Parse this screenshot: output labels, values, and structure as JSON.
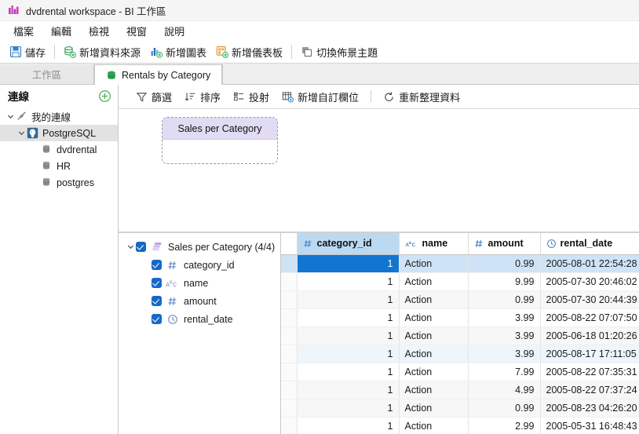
{
  "window": {
    "title": "dvdrental workspace - BI 工作區",
    "icon": "bar-chart-icon"
  },
  "menubar": {
    "items": [
      {
        "label": "檔案"
      },
      {
        "label": "編輯"
      },
      {
        "label": "檢視"
      },
      {
        "label": "視窗"
      },
      {
        "label": "說明"
      }
    ]
  },
  "toolbar": {
    "items": [
      {
        "label": "儲存",
        "icon": "save-icon"
      },
      {
        "label": "新增資料來源",
        "icon": "add-datasource-icon"
      },
      {
        "label": "新增圖表",
        "icon": "add-chart-icon"
      },
      {
        "label": "新增儀表板",
        "icon": "add-dashboard-icon"
      },
      {
        "label": "切換佈景主題",
        "icon": "switch-theme-icon"
      }
    ]
  },
  "tabs": [
    {
      "label": "工作區",
      "active": false
    },
    {
      "label": "Rentals by Category",
      "active": true,
      "icon": "database-icon"
    }
  ],
  "sidebar": {
    "title": "連線",
    "add_button": "add-connection-icon",
    "tree": [
      {
        "label": "我的連線",
        "icon": "connection-icon",
        "depth": 0,
        "expanded": true,
        "selected": false
      },
      {
        "label": "PostgreSQL",
        "icon": "postgresql-icon",
        "depth": 1,
        "expanded": true,
        "selected": true
      },
      {
        "label": "dvdrental",
        "icon": "database-icon",
        "depth": 2,
        "expanded": null,
        "selected": false
      },
      {
        "label": "HR",
        "icon": "database-icon",
        "depth": 2,
        "expanded": null,
        "selected": false
      },
      {
        "label": "postgres",
        "icon": "database-icon",
        "depth": 2,
        "expanded": null,
        "selected": false
      }
    ]
  },
  "subtoolbar": {
    "items": [
      {
        "label": "篩選",
        "icon": "filter-icon"
      },
      {
        "label": "排序",
        "icon": "sort-icon"
      },
      {
        "label": "投射",
        "icon": "project-icon"
      },
      {
        "label": "新增自訂欄位",
        "icon": "add-column-icon"
      },
      {
        "label": "重新整理資料",
        "icon": "refresh-icon"
      }
    ]
  },
  "canvas": {
    "node": {
      "title": "Sales per Category"
    }
  },
  "fieldtree": {
    "root": {
      "label": "Sales per Category (4/4)",
      "checked": true,
      "icon": "dataset-icon"
    },
    "fields": [
      {
        "label": "category_id",
        "type": "number",
        "checked": true
      },
      {
        "label": "name",
        "type": "text",
        "checked": true
      },
      {
        "label": "amount",
        "type": "number",
        "checked": true
      },
      {
        "label": "rental_date",
        "type": "datetime",
        "checked": true
      }
    ]
  },
  "table": {
    "columns": [
      {
        "label": "category_id",
        "type": "number",
        "selected": true,
        "align": "right"
      },
      {
        "label": "name",
        "type": "text",
        "selected": false,
        "align": "left"
      },
      {
        "label": "amount",
        "type": "number",
        "selected": false,
        "align": "right"
      },
      {
        "label": "rental_date",
        "type": "datetime",
        "selected": false,
        "align": "left"
      }
    ],
    "rows": [
      {
        "cells": [
          "1",
          "Action",
          "0.99",
          "2005-08-01 22:54:28"
        ],
        "state": "selected"
      },
      {
        "cells": [
          "1",
          "Action",
          "9.99",
          "2005-07-30 20:46:02"
        ],
        "state": "normal"
      },
      {
        "cells": [
          "1",
          "Action",
          "0.99",
          "2005-07-30 20:44:39"
        ],
        "state": "alt"
      },
      {
        "cells": [
          "1",
          "Action",
          "3.99",
          "2005-08-22 07:07:50"
        ],
        "state": "normal"
      },
      {
        "cells": [
          "1",
          "Action",
          "3.99",
          "2005-06-18 01:20:26"
        ],
        "state": "alt"
      },
      {
        "cells": [
          "1",
          "Action",
          "3.99",
          "2005-08-17 17:11:05"
        ],
        "state": "hover"
      },
      {
        "cells": [
          "1",
          "Action",
          "7.99",
          "2005-08-22 07:35:31"
        ],
        "state": "normal"
      },
      {
        "cells": [
          "1",
          "Action",
          "4.99",
          "2005-08-22 07:37:24"
        ],
        "state": "alt"
      },
      {
        "cells": [
          "1",
          "Action",
          "0.99",
          "2005-08-23 04:26:20"
        ],
        "state": "alt"
      },
      {
        "cells": [
          "1",
          "Action",
          "2.99",
          "2005-05-31 16:48:43"
        ],
        "state": "normal"
      }
    ]
  },
  "colors": {
    "accent_blue": "#1275d1",
    "node_header": "#e2dbf4",
    "column_selected": "#bcd9f2",
    "checkbox": "#1669c8",
    "add_green": "#4caf50"
  }
}
